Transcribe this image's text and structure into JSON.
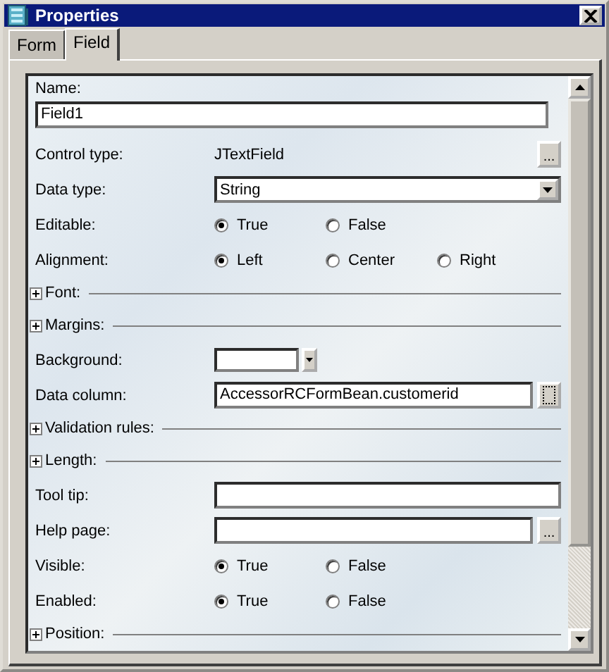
{
  "window": {
    "title": "Properties"
  },
  "tabs": [
    {
      "label": "Form",
      "selected": false
    },
    {
      "label": "Field",
      "selected": true
    }
  ],
  "properties": [
    {
      "kind": "field_above",
      "label": "Name:",
      "value": "Field1"
    },
    {
      "kind": "text",
      "label": "Control type:",
      "value": "JTextField",
      "button": "..."
    },
    {
      "kind": "select",
      "label": "Data type:",
      "value": "String"
    },
    {
      "kind": "radio",
      "label": "Editable:",
      "options": [
        {
          "label": "True",
          "selected": true
        },
        {
          "label": "False",
          "selected": false
        }
      ]
    },
    {
      "kind": "radio",
      "label": "Alignment:",
      "options": [
        {
          "label": "Left",
          "selected": true
        },
        {
          "label": "Center",
          "selected": false
        },
        {
          "label": "Right",
          "selected": false
        }
      ]
    },
    {
      "kind": "section",
      "label": "Font:",
      "expanded": false
    },
    {
      "kind": "section",
      "label": "Margins:",
      "expanded": false
    },
    {
      "kind": "color",
      "label": "Background:"
    },
    {
      "kind": "field",
      "label": "Data column:",
      "value": "AccessorRCFormBean.customerid",
      "button_focused": true
    },
    {
      "kind": "section",
      "label": "Validation rules:",
      "expanded": false
    },
    {
      "kind": "section",
      "label": "Length:",
      "expanded": false
    },
    {
      "kind": "field",
      "label": "Tool tip:"
    },
    {
      "kind": "field",
      "label": "Help page:",
      "button": "..."
    },
    {
      "kind": "radio",
      "label": "Visible:",
      "options": [
        {
          "label": "True",
          "selected": true
        },
        {
          "label": "False",
          "selected": false
        }
      ]
    },
    {
      "kind": "radio",
      "label": "Enabled:",
      "options": [
        {
          "label": "True",
          "selected": true
        },
        {
          "label": "False",
          "selected": false
        }
      ]
    },
    {
      "kind": "section",
      "label": "Position:",
      "expanded": false
    }
  ]
}
